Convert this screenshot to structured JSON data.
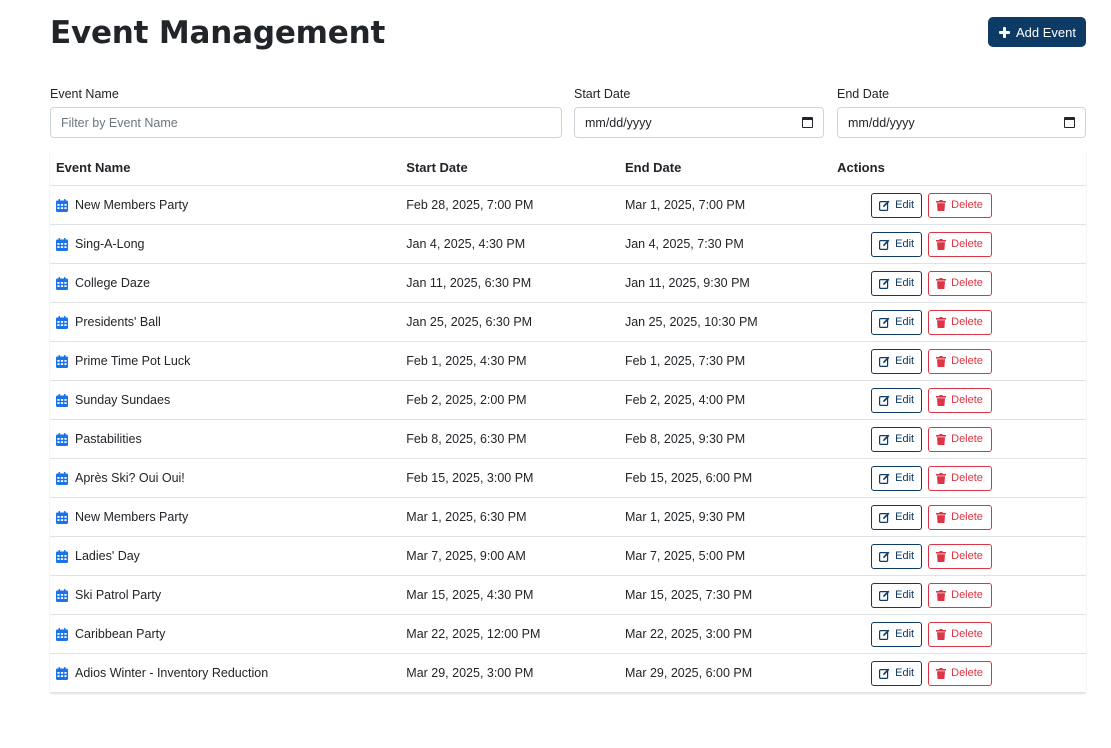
{
  "header": {
    "title": "Event Management",
    "add_button_label": "Add Event"
  },
  "filters": {
    "event_name": {
      "label": "Event Name",
      "placeholder": "Filter by Event Name",
      "value": ""
    },
    "start_date": {
      "label": "Start Date",
      "value": "mm/dd/yyyy"
    },
    "end_date": {
      "label": "End Date",
      "value": "mm/dd/yyyy"
    }
  },
  "table": {
    "columns": [
      "Event Name",
      "Start Date",
      "End Date",
      "Actions"
    ],
    "edit_label": "Edit",
    "delete_label": "Delete",
    "rows": [
      {
        "name": "New Members Party",
        "start": "Feb 28, 2025, 7:00 PM",
        "end": "Mar 1, 2025, 7:00 PM"
      },
      {
        "name": "Sing-A-Long",
        "start": "Jan 4, 2025, 4:30 PM",
        "end": "Jan 4, 2025, 7:30 PM"
      },
      {
        "name": "College Daze",
        "start": "Jan 11, 2025, 6:30 PM",
        "end": "Jan 11, 2025, 9:30 PM"
      },
      {
        "name": "Presidents' Ball",
        "start": "Jan 25, 2025, 6:30 PM",
        "end": "Jan 25, 2025, 10:30 PM"
      },
      {
        "name": "Prime Time Pot Luck",
        "start": "Feb 1, 2025, 4:30 PM",
        "end": "Feb 1, 2025, 7:30 PM"
      },
      {
        "name": "Sunday Sundaes",
        "start": "Feb 2, 2025, 2:00 PM",
        "end": "Feb 2, 2025, 4:00 PM"
      },
      {
        "name": "Pastabilities",
        "start": "Feb 8, 2025, 6:30 PM",
        "end": "Feb 8, 2025, 9:30 PM"
      },
      {
        "name": "Après Ski? Oui Oui!",
        "start": "Feb 15, 2025, 3:00 PM",
        "end": "Feb 15, 2025, 6:00 PM"
      },
      {
        "name": "New Members Party",
        "start": "Mar 1, 2025, 6:30 PM",
        "end": "Mar 1, 2025, 9:30 PM"
      },
      {
        "name": "Ladies' Day",
        "start": "Mar 7, 2025, 9:00 AM",
        "end": "Mar 7, 2025, 5:00 PM"
      },
      {
        "name": "Ski Patrol Party",
        "start": "Mar 15, 2025, 4:30 PM",
        "end": "Mar 15, 2025, 7:30 PM"
      },
      {
        "name": "Caribbean Party",
        "start": "Mar 22, 2025, 12:00 PM",
        "end": "Mar 22, 2025, 3:00 PM"
      },
      {
        "name": "Adios Winter - Inventory Reduction",
        "start": "Mar 29, 2025, 3:00 PM",
        "end": "Mar 29, 2025, 6:00 PM"
      }
    ]
  },
  "icons": {
    "add": "plus-icon",
    "event": "calendar-icon",
    "edit": "edit-icon",
    "delete": "trash-icon",
    "date_picker": "calendar-icon"
  },
  "colors": {
    "primary": "#0d3b66",
    "danger": "#dc3545",
    "event_icon": "#1a73e8",
    "border": "#dee2e6"
  }
}
